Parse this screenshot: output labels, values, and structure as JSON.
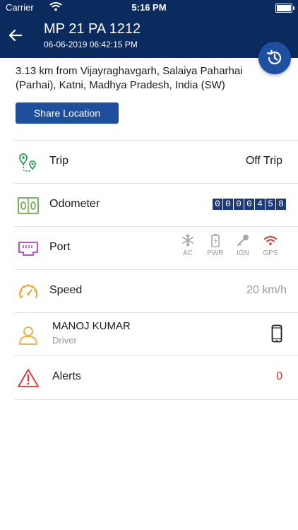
{
  "status_bar": {
    "carrier": "Carrier",
    "time": "5:16 PM"
  },
  "header": {
    "title": "MP 21 PA 1212",
    "subtitle": "06-06-2019 06:42:15 PM"
  },
  "location": {
    "address": "3.13 km from Vijayraghavgarh, Salaiya Paharhai (Parhai), Katni, Madhya Pradesh, India (SW)",
    "share_label": "Share Location"
  },
  "rows": {
    "trip": {
      "label": "Trip",
      "value": "Off Trip"
    },
    "odometer": {
      "label": "Odometer",
      "digits": [
        "0",
        "0",
        "0",
        "0",
        "4",
        "5",
        "8"
      ]
    },
    "port": {
      "label": "Port",
      "items": [
        {
          "label": "AC"
        },
        {
          "label": "PWR"
        },
        {
          "label": "IGN"
        },
        {
          "label": "GPS"
        }
      ]
    },
    "speed": {
      "label": "Speed",
      "value": "20 km/h"
    },
    "driver": {
      "name": "MANOJ KUMAR",
      "role": "Driver"
    },
    "alerts": {
      "label": "Alerts",
      "value": "0"
    }
  },
  "colors": {
    "header_bg": "#0b2a5e",
    "button_bg": "#1e4f9c",
    "trip_icon": "#2e9e4f",
    "odometer_icon": "#6aa84f",
    "port_icon": "#b43bc8",
    "speed_icon": "#f0a020",
    "driver_icon": "#e8b040",
    "alert_icon": "#e03030",
    "gps_active": "#e03030"
  }
}
